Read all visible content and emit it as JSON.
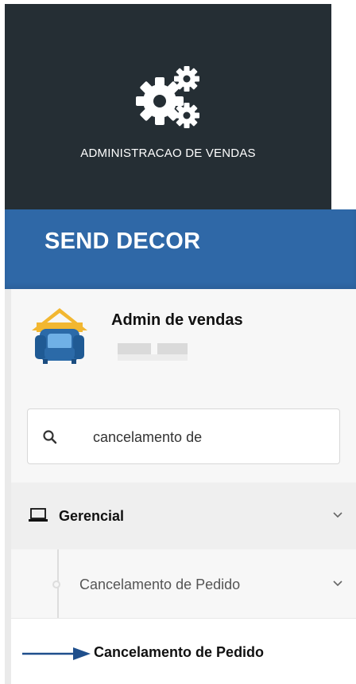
{
  "tile": {
    "icon": "gears-icon",
    "title": "ADMINISTRACAO DE VENDAS"
  },
  "header": {
    "app_name": "SEND DECOR",
    "bg_color": "#2f68a7"
  },
  "sidebar": {
    "brand": {
      "logo": "sofa-house-logo",
      "name": "Admin de vendas"
    },
    "search": {
      "icon": "search-icon",
      "value": "cancelamento de"
    },
    "menu": [
      {
        "icon": "laptop-icon",
        "label": "Gerencial",
        "expanded": true
      },
      {
        "label": "Cancelamento de Pedido",
        "expanded": true
      },
      {
        "label": "Cancelamento de Pedido",
        "highlighted": true
      }
    ]
  },
  "annotation": {
    "icon": "arrow-right-icon",
    "color": "#1f4f8c"
  }
}
